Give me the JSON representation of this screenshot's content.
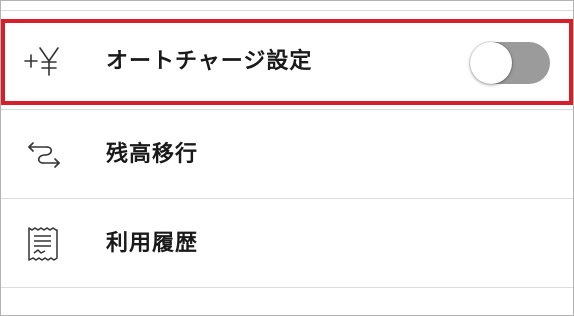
{
  "settings": {
    "items": [
      {
        "label": "オートチャージ設定",
        "icon": "yen-plus-icon",
        "has_toggle": true,
        "toggle_on": false
      },
      {
        "label": "残高移行",
        "icon": "transfer-arrows-icon",
        "has_toggle": false
      },
      {
        "label": "利用履歴",
        "icon": "receipt-icon",
        "has_toggle": false
      }
    ],
    "highlight_color": "#d71e2b",
    "toggle_off_color": "#9b9b9b"
  }
}
